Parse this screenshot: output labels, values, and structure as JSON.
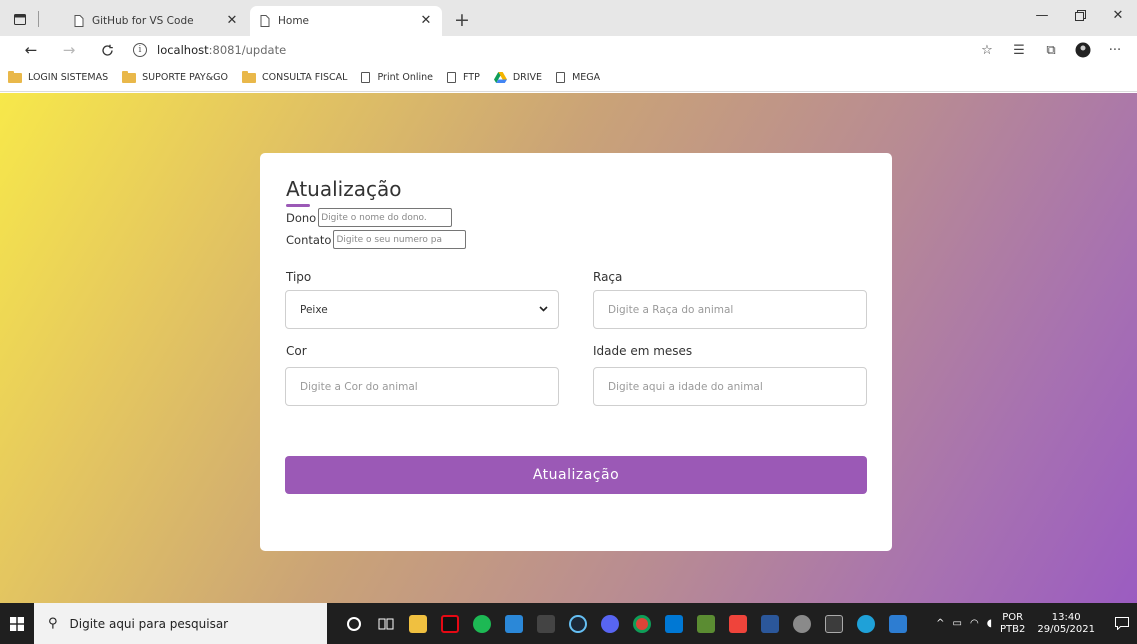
{
  "browser": {
    "tabs": [
      {
        "title": "GitHub for VS Code",
        "active": false
      },
      {
        "title": "Home",
        "active": true
      }
    ],
    "url": {
      "host": "localhost",
      "path": ":8081/update"
    },
    "bookmarks": [
      {
        "label": "LOGIN SISTEMAS",
        "icon": "folder"
      },
      {
        "label": "SUPORTE PAY&GO",
        "icon": "folder"
      },
      {
        "label": "CONSULTA FISCAL",
        "icon": "folder"
      },
      {
        "label": "Print Online",
        "icon": "page"
      },
      {
        "label": "FTP",
        "icon": "page"
      },
      {
        "label": "DRIVE",
        "icon": "drive"
      },
      {
        "label": "MEGA",
        "icon": "page"
      }
    ]
  },
  "form": {
    "title": "Atualização",
    "dono": {
      "label": "Dono",
      "placeholder": "Digite o nome do dono."
    },
    "contato": {
      "label": "Contato",
      "placeholder": "Digite o seu numero pa"
    },
    "tipo": {
      "label": "Tipo",
      "value": "Peixe"
    },
    "raca": {
      "label": "Raça",
      "placeholder": "Digite a Raça do animal"
    },
    "cor": {
      "label": "Cor",
      "placeholder": "Digite a Cor do animal"
    },
    "idade": {
      "label": "Idade em meses",
      "placeholder": "Digite aqui a idade do animal"
    },
    "submit": "Atualização"
  },
  "taskbar": {
    "search_placeholder": "Digite aqui para pesquisar",
    "lang_top": "POR",
    "lang_bottom": "PTB2",
    "time": "13:40",
    "date": "29/05/2021"
  },
  "colors": {
    "accent": "#9b59b6",
    "gradient_start": "#f7e84a",
    "gradient_end": "#9b5cc1"
  }
}
